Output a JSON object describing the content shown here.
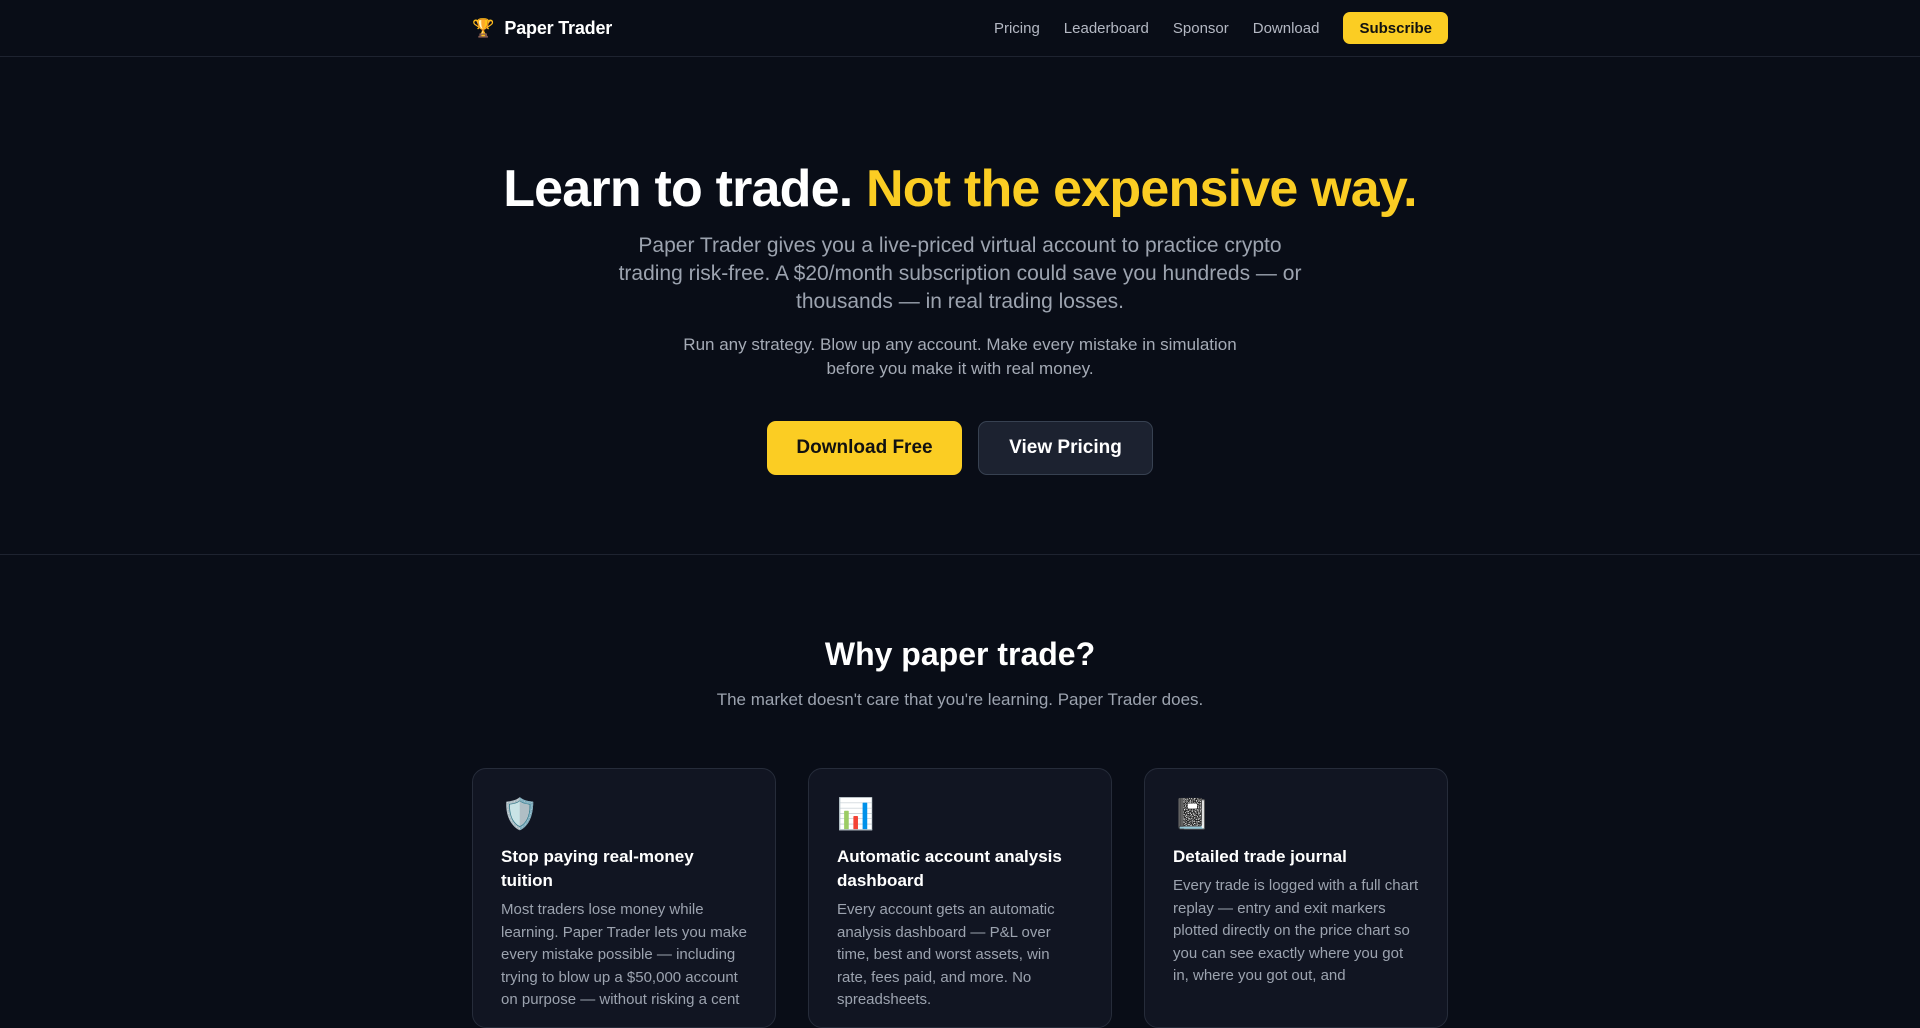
{
  "nav": {
    "brand_icon": "🏆",
    "brand_name": "Paper Trader",
    "links": [
      "Pricing",
      "Leaderboard",
      "Sponsor",
      "Download"
    ],
    "subscribe_label": "Subscribe"
  },
  "hero": {
    "title_main": "Learn to trade.",
    "title_accent": "Not the expensive way.",
    "lead": "Paper Trader gives you a live-priced virtual account to practice crypto trading risk-free. A $20/month subscription could save you hundreds — or thousands — in real trading losses.",
    "sub": "Run any strategy. Blow up any account. Make every mistake in simulation before you make it with real money.",
    "primary_cta": "Download Free",
    "secondary_cta": "View Pricing"
  },
  "why": {
    "title": "Why paper trade?",
    "subtitle": "The market doesn't care that you're learning. Paper Trader does.",
    "cards": [
      {
        "icon": "🛡️",
        "icon_name": "shield-icon",
        "title": "Stop paying real-money tuition",
        "body": "Most traders lose money while learning. Paper Trader lets you make every mistake possible — including trying to blow up a $50,000 account on purpose — without risking a cent"
      },
      {
        "icon": "📊",
        "icon_name": "bar-chart-icon",
        "title": "Automatic account analysis dashboard",
        "body": "Every account gets an automatic analysis dashboard — P&L over time, best and worst assets, win rate, fees paid, and more. No spreadsheets."
      },
      {
        "icon": "📓",
        "icon_name": "notebook-icon",
        "title": "Detailed trade journal",
        "body": "Every trade is logged with a full chart replay — entry and exit markers plotted directly on the price chart so you can see exactly where you got in, where you got out, and"
      }
    ]
  },
  "colors": {
    "background": "#090d17",
    "accent": "#fbcd23",
    "card_bg": "#111522",
    "border": "#1e2330"
  }
}
